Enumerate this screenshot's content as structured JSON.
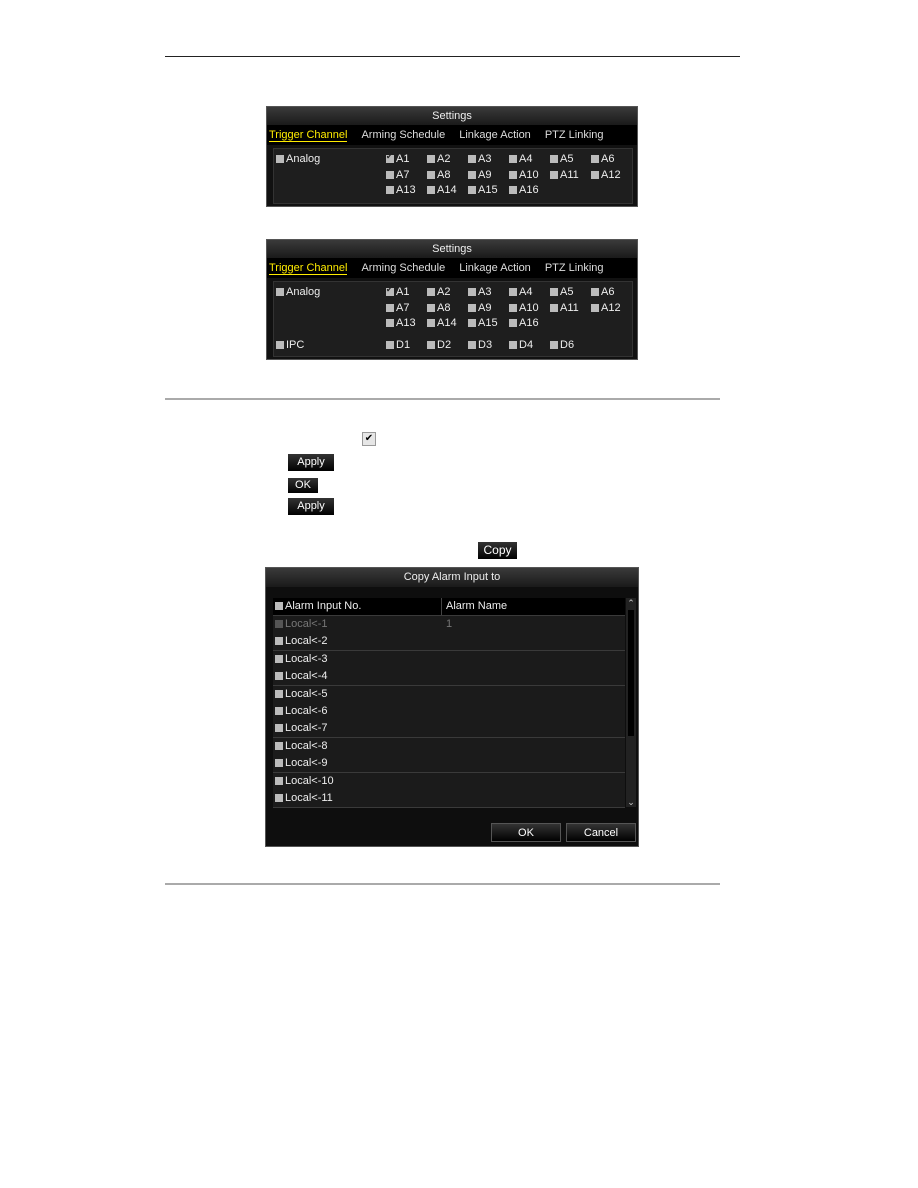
{
  "panel1": {
    "title": "Settings",
    "tabs": [
      "Trigger Channel",
      "Arming Schedule",
      "Linkage Action",
      "PTZ Linking"
    ],
    "group": "Analog",
    "channels": [
      "A1",
      "A2",
      "A3",
      "A4",
      "A5",
      "A6",
      "A7",
      "A8",
      "A9",
      "A10",
      "A11",
      "A12",
      "A13",
      "A14",
      "A15",
      "A16"
    ],
    "checked": [
      "A1"
    ]
  },
  "panel2": {
    "title": "Settings",
    "tabs": [
      "Trigger Channel",
      "Arming Schedule",
      "Linkage Action",
      "PTZ Linking"
    ],
    "group": "Analog",
    "channels": [
      "A1",
      "A2",
      "A3",
      "A4",
      "A5",
      "A6",
      "A7",
      "A8",
      "A9",
      "A10",
      "A11",
      "A12",
      "A13",
      "A14",
      "A15",
      "A16"
    ],
    "checked": [
      "A1"
    ],
    "ipc_group": "IPC",
    "ipc_channels": [
      "D1",
      "D2",
      "D3",
      "D4",
      "D6"
    ]
  },
  "icons": {
    "apply1": "Apply",
    "ok": "OK",
    "apply2": "Apply",
    "copy": "Copy"
  },
  "dialog": {
    "title": "Copy Alarm Input to",
    "col1": "Alarm Input No.",
    "col2": "Alarm Name",
    "rows": [
      {
        "no": "Local<-1",
        "name": "1",
        "disabled": true
      },
      {
        "no": "Local<-2",
        "name": ""
      },
      {
        "no": "Local<-3",
        "name": ""
      },
      {
        "no": "Local<-4",
        "name": ""
      },
      {
        "no": "Local<-5",
        "name": ""
      },
      {
        "no": "Local<-6",
        "name": ""
      },
      {
        "no": "Local<-7",
        "name": ""
      },
      {
        "no": "Local<-8",
        "name": ""
      },
      {
        "no": "Local<-9",
        "name": ""
      },
      {
        "no": "Local<-10",
        "name": ""
      },
      {
        "no": "Local<-11",
        "name": ""
      }
    ],
    "ok": "OK",
    "cancel": "Cancel"
  }
}
